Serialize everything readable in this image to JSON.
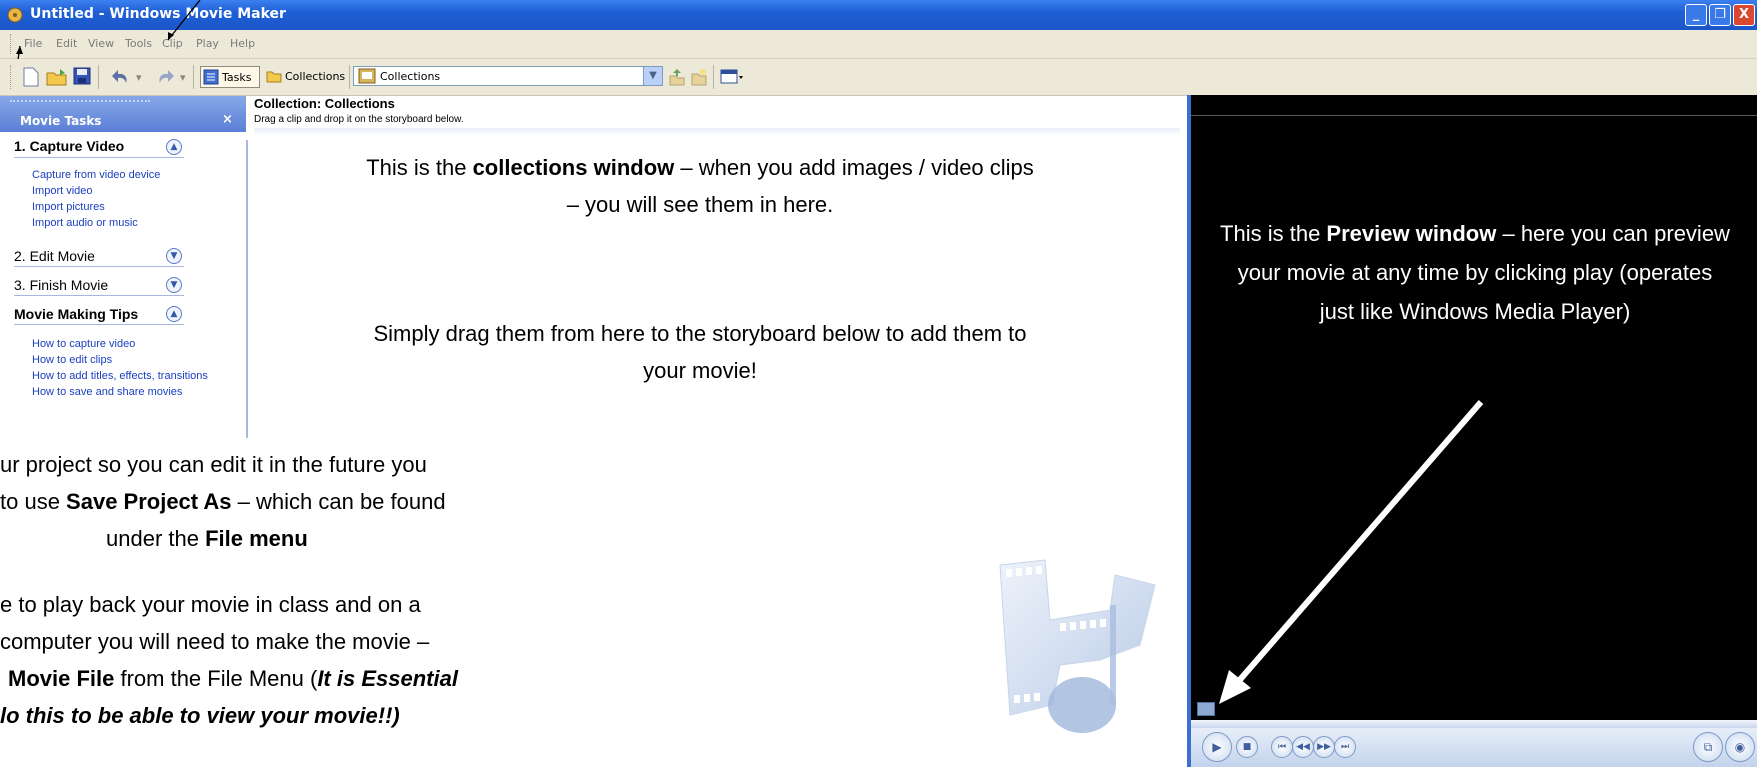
{
  "window": {
    "title": "Untitled - Windows Movie Maker",
    "buttons": {
      "minimize": "_",
      "maximize": "❐",
      "close": "X"
    }
  },
  "menu": {
    "items": [
      "File",
      "Edit",
      "View",
      "Tools",
      "Clip",
      "Play",
      "Help"
    ]
  },
  "toolbar": {
    "tasks_label": "Tasks",
    "collections_label": "Collections",
    "collections_select_value": "Collections"
  },
  "task_pane": {
    "header": "Movie Tasks",
    "close_glyph": "×",
    "sections": [
      {
        "title": "1. Capture Video",
        "expanded": true,
        "links": [
          "Capture from video device",
          "Import video",
          "Import pictures",
          "Import audio or music"
        ]
      },
      {
        "title": "2. Edit Movie",
        "expanded": false,
        "links": []
      },
      {
        "title": "3. Finish Movie",
        "expanded": false,
        "links": []
      },
      {
        "title": "Movie Making Tips",
        "expanded": true,
        "links": [
          "How to capture video",
          "How to edit clips",
          "How to add titles, effects, transitions",
          "How to save and share movies"
        ]
      }
    ]
  },
  "collection": {
    "title": "Collection: Collections",
    "subtitle": "Drag a clip and drop it on the storyboard below."
  },
  "annotations": {
    "collections_window": {
      "before": "This is the ",
      "bold": "collections window",
      "after": " – when you add images / video clips – you will see them in here."
    },
    "drag": "Simply drag them from here to the storyboard below to add them to your movie!",
    "save_project": {
      "line1": "ur project so you can edit it in the future you",
      "line2_before": "to use ",
      "line2_bold": "Save Project As",
      "line2_after": " – which can be found",
      "line3_before": "under the ",
      "line3_bold": "File menu"
    },
    "save_movie": {
      "line1": "e to play back your movie in class and on a",
      "line2": "computer you will need to make the movie –",
      "line3_bold": "Movie File",
      "line3_mid": " from the File Menu (",
      "line3_bold_italic": "It is Essential",
      "line4_bold_italic": "lo this to be able to view your movie!!)"
    },
    "preview_window": {
      "before": "This is the ",
      "bold": "Preview window",
      "after": " – here you can preview your movie at any time by clicking play (operates just like Windows Media Player)"
    }
  },
  "icons": {
    "app": "movie-maker-icon",
    "new": "new-project-icon",
    "open": "open-project-icon",
    "save": "save-project-icon",
    "undo": "undo-icon",
    "redo": "redo-icon",
    "tasks": "tasks-icon",
    "collections": "collections-folder-icon",
    "up": "up-level-icon",
    "new_collection": "new-collection-icon",
    "views": "views-icon"
  },
  "colors": {
    "titlebar": "#1f5fd6",
    "chrome": "#ece9d8",
    "link": "#1a3fbf",
    "preview_bg": "#000000",
    "close": "#d9482f"
  }
}
